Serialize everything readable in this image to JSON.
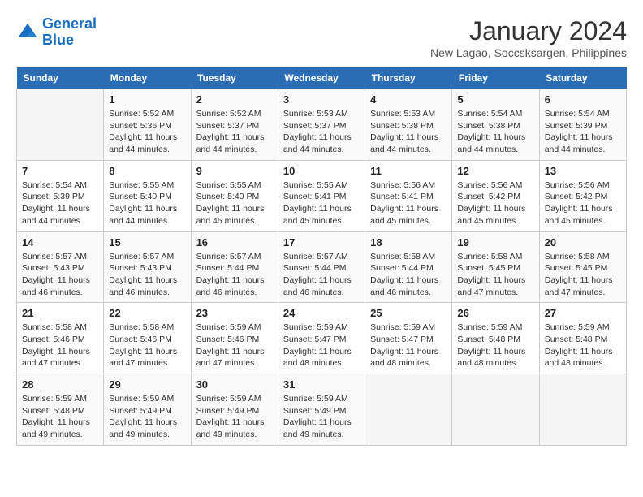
{
  "header": {
    "logo_line1": "General",
    "logo_line2": "Blue",
    "title": "January 2024",
    "subtitle": "New Lagao, Soccsksargen, Philippines"
  },
  "days_of_week": [
    "Sunday",
    "Monday",
    "Tuesday",
    "Wednesday",
    "Thursday",
    "Friday",
    "Saturday"
  ],
  "weeks": [
    [
      {
        "day": "",
        "empty": true
      },
      {
        "day": "1",
        "sunrise": "5:52 AM",
        "sunset": "5:36 PM",
        "daylight": "11 hours and 44 minutes."
      },
      {
        "day": "2",
        "sunrise": "5:52 AM",
        "sunset": "5:37 PM",
        "daylight": "11 hours and 44 minutes."
      },
      {
        "day": "3",
        "sunrise": "5:53 AM",
        "sunset": "5:37 PM",
        "daylight": "11 hours and 44 minutes."
      },
      {
        "day": "4",
        "sunrise": "5:53 AM",
        "sunset": "5:38 PM",
        "daylight": "11 hours and 44 minutes."
      },
      {
        "day": "5",
        "sunrise": "5:54 AM",
        "sunset": "5:38 PM",
        "daylight": "11 hours and 44 minutes."
      },
      {
        "day": "6",
        "sunrise": "5:54 AM",
        "sunset": "5:39 PM",
        "daylight": "11 hours and 44 minutes."
      }
    ],
    [
      {
        "day": "7",
        "sunrise": "5:54 AM",
        "sunset": "5:39 PM",
        "daylight": "11 hours and 44 minutes."
      },
      {
        "day": "8",
        "sunrise": "5:55 AM",
        "sunset": "5:40 PM",
        "daylight": "11 hours and 44 minutes."
      },
      {
        "day": "9",
        "sunrise": "5:55 AM",
        "sunset": "5:40 PM",
        "daylight": "11 hours and 45 minutes."
      },
      {
        "day": "10",
        "sunrise": "5:55 AM",
        "sunset": "5:41 PM",
        "daylight": "11 hours and 45 minutes."
      },
      {
        "day": "11",
        "sunrise": "5:56 AM",
        "sunset": "5:41 PM",
        "daylight": "11 hours and 45 minutes."
      },
      {
        "day": "12",
        "sunrise": "5:56 AM",
        "sunset": "5:42 PM",
        "daylight": "11 hours and 45 minutes."
      },
      {
        "day": "13",
        "sunrise": "5:56 AM",
        "sunset": "5:42 PM",
        "daylight": "11 hours and 45 minutes."
      }
    ],
    [
      {
        "day": "14",
        "sunrise": "5:57 AM",
        "sunset": "5:43 PM",
        "daylight": "11 hours and 46 minutes."
      },
      {
        "day": "15",
        "sunrise": "5:57 AM",
        "sunset": "5:43 PM",
        "daylight": "11 hours and 46 minutes."
      },
      {
        "day": "16",
        "sunrise": "5:57 AM",
        "sunset": "5:44 PM",
        "daylight": "11 hours and 46 minutes."
      },
      {
        "day": "17",
        "sunrise": "5:57 AM",
        "sunset": "5:44 PM",
        "daylight": "11 hours and 46 minutes."
      },
      {
        "day": "18",
        "sunrise": "5:58 AM",
        "sunset": "5:44 PM",
        "daylight": "11 hours and 46 minutes."
      },
      {
        "day": "19",
        "sunrise": "5:58 AM",
        "sunset": "5:45 PM",
        "daylight": "11 hours and 47 minutes."
      },
      {
        "day": "20",
        "sunrise": "5:58 AM",
        "sunset": "5:45 PM",
        "daylight": "11 hours and 47 minutes."
      }
    ],
    [
      {
        "day": "21",
        "sunrise": "5:58 AM",
        "sunset": "5:46 PM",
        "daylight": "11 hours and 47 minutes."
      },
      {
        "day": "22",
        "sunrise": "5:58 AM",
        "sunset": "5:46 PM",
        "daylight": "11 hours and 47 minutes."
      },
      {
        "day": "23",
        "sunrise": "5:59 AM",
        "sunset": "5:46 PM",
        "daylight": "11 hours and 47 minutes."
      },
      {
        "day": "24",
        "sunrise": "5:59 AM",
        "sunset": "5:47 PM",
        "daylight": "11 hours and 48 minutes."
      },
      {
        "day": "25",
        "sunrise": "5:59 AM",
        "sunset": "5:47 PM",
        "daylight": "11 hours and 48 minutes."
      },
      {
        "day": "26",
        "sunrise": "5:59 AM",
        "sunset": "5:48 PM",
        "daylight": "11 hours and 48 minutes."
      },
      {
        "day": "27",
        "sunrise": "5:59 AM",
        "sunset": "5:48 PM",
        "daylight": "11 hours and 48 minutes."
      }
    ],
    [
      {
        "day": "28",
        "sunrise": "5:59 AM",
        "sunset": "5:48 PM",
        "daylight": "11 hours and 49 minutes."
      },
      {
        "day": "29",
        "sunrise": "5:59 AM",
        "sunset": "5:49 PM",
        "daylight": "11 hours and 49 minutes."
      },
      {
        "day": "30",
        "sunrise": "5:59 AM",
        "sunset": "5:49 PM",
        "daylight": "11 hours and 49 minutes."
      },
      {
        "day": "31",
        "sunrise": "5:59 AM",
        "sunset": "5:49 PM",
        "daylight": "11 hours and 49 minutes."
      },
      {
        "day": "",
        "empty": true
      },
      {
        "day": "",
        "empty": true
      },
      {
        "day": "",
        "empty": true
      }
    ]
  ],
  "labels": {
    "sunrise_prefix": "Sunrise: ",
    "sunset_prefix": "Sunset: ",
    "daylight_prefix": "Daylight: "
  }
}
